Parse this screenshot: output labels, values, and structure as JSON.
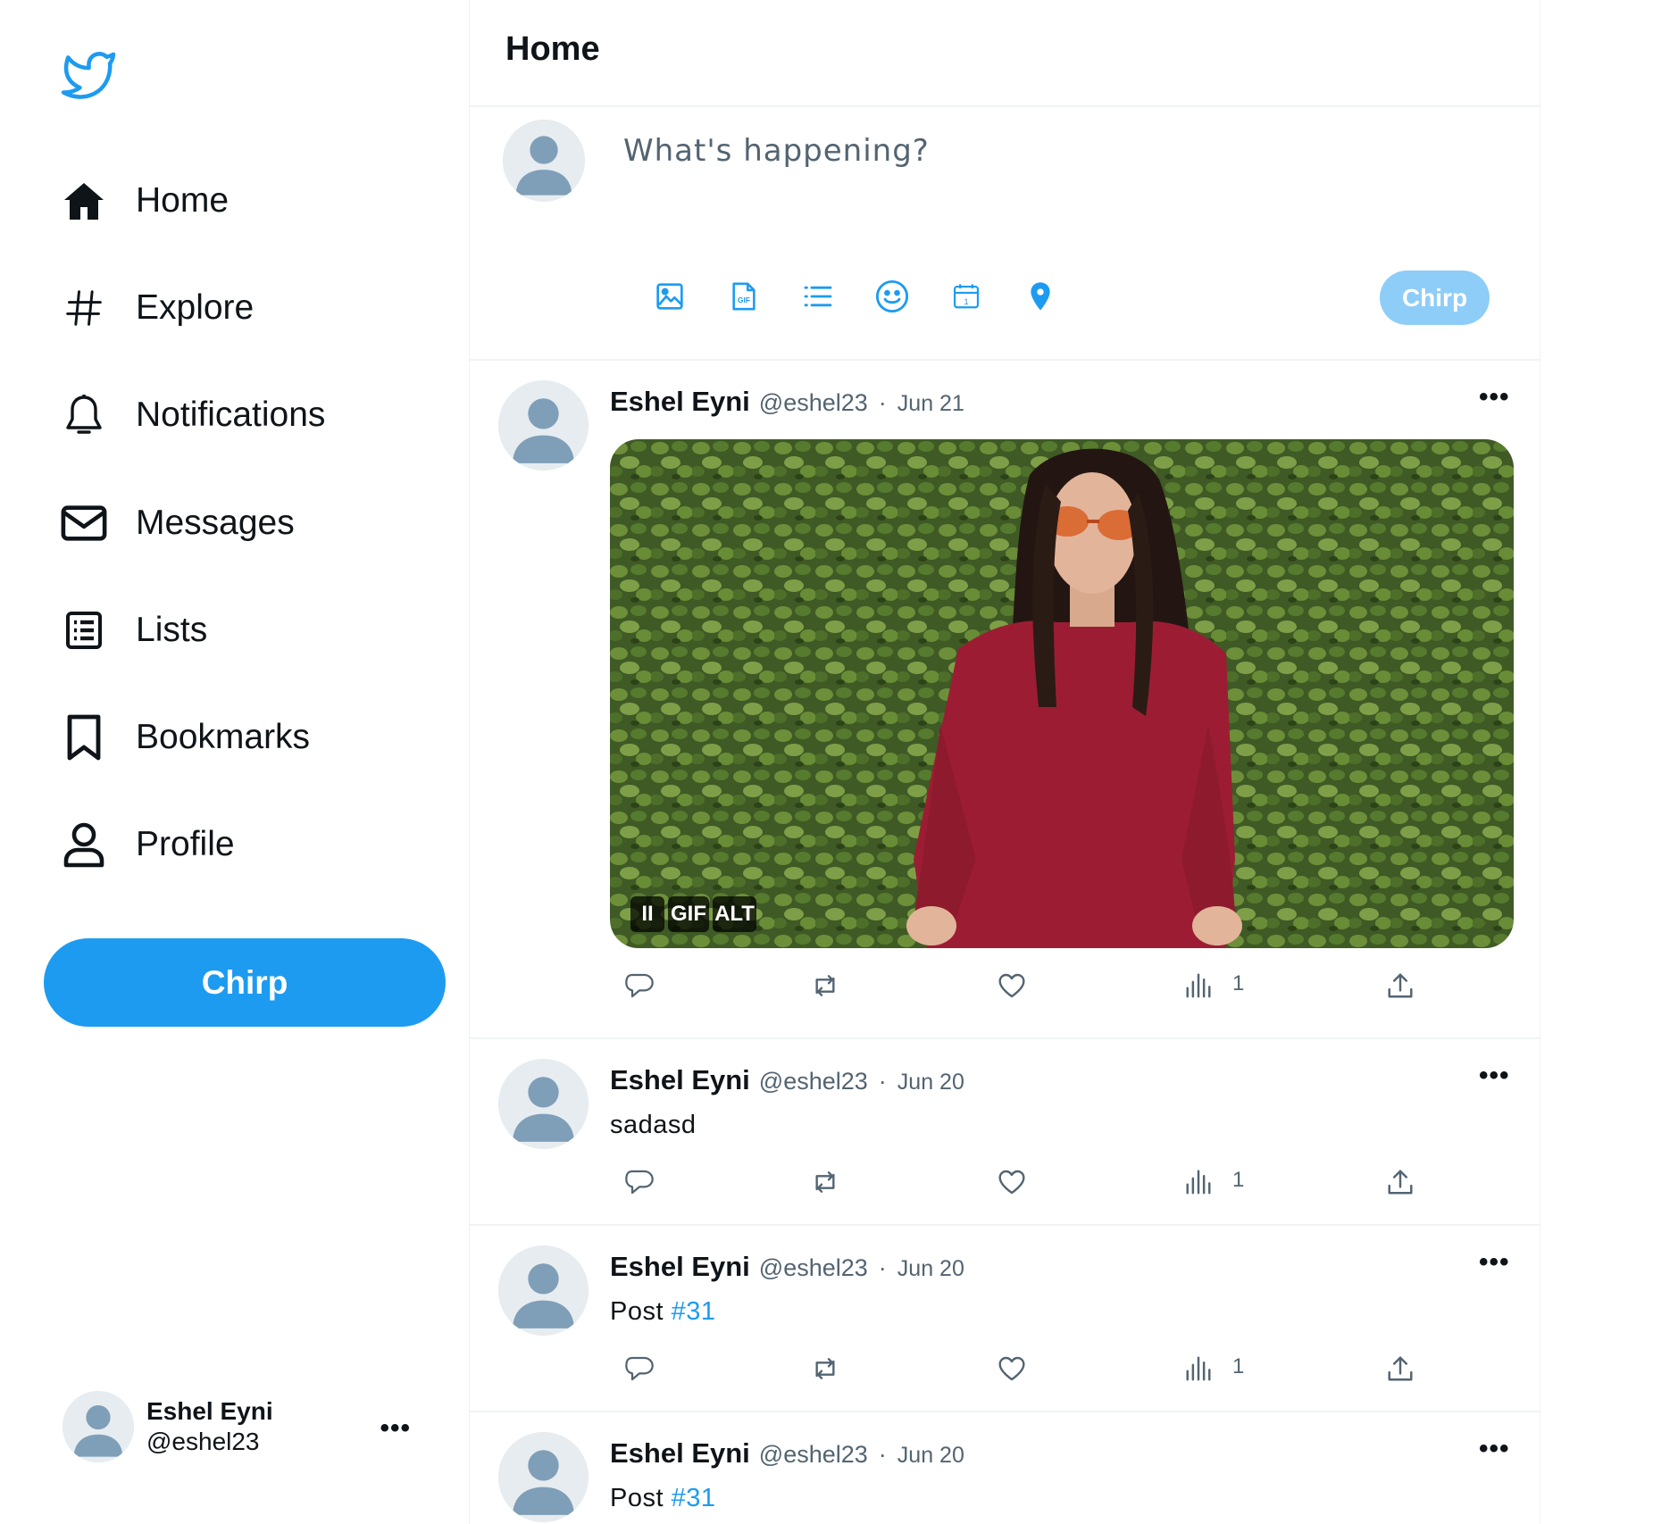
{
  "app": {
    "brand_color": "#1d9bf0",
    "logo_icon": "bird-icon"
  },
  "sidebar": {
    "items": [
      {
        "label": "Home",
        "icon": "home-icon"
      },
      {
        "label": "Explore",
        "icon": "hashtag-icon"
      },
      {
        "label": "Notifications",
        "icon": "bell-icon"
      },
      {
        "label": "Messages",
        "icon": "envelope-icon"
      },
      {
        "label": "Lists",
        "icon": "list-icon"
      },
      {
        "label": "Bookmarks",
        "icon": "bookmark-icon"
      },
      {
        "label": "Profile",
        "icon": "user-icon"
      }
    ],
    "chirp_label": "Chirp",
    "account": {
      "name": "Eshel Eyni",
      "handle": "@eshel23",
      "more": "•••"
    }
  },
  "main": {
    "title": "Home",
    "composer": {
      "placeholder": "What's happening?",
      "tools": [
        "image-icon",
        "gif-icon",
        "poll-icon",
        "emoji-icon",
        "schedule-icon",
        "location-icon"
      ],
      "chirp_label": "Chirp",
      "chirp_color": "#8ecdf8"
    },
    "posts": [
      {
        "name": "Eshel Eyni",
        "handle": "@eshel23",
        "dot": "·",
        "date": "Jun 21",
        "more": "•••",
        "text": "",
        "media": {
          "type": "gif",
          "pause": "II",
          "gif_label": "GIF",
          "alt_label": "ALT"
        },
        "views": "1"
      },
      {
        "name": "Eshel Eyni",
        "handle": "@eshel23",
        "dot": "·",
        "date": "Jun 20",
        "more": "•••",
        "text": "sadasd",
        "views": "1"
      },
      {
        "name": "Eshel Eyni",
        "handle": "@eshel23",
        "dot": "·",
        "date": "Jun 20",
        "more": "•••",
        "text": "Post",
        "tag": "#31",
        "views": "1"
      },
      {
        "name": "Eshel Eyni",
        "handle": "@eshel23",
        "dot": "·",
        "date": "Jun 20",
        "more": "•••",
        "text": "Post",
        "tag": "#31"
      }
    ]
  }
}
